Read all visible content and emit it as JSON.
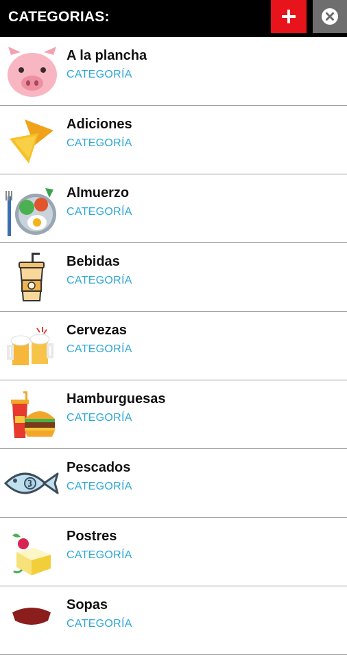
{
  "header": {
    "title": "CATEGORIAS:",
    "add_icon": "plus-icon",
    "close_icon": "close-circle-icon",
    "add_color": "#e8141c",
    "close_color": "#6e6e6e"
  },
  "categories": [
    {
      "name": "A la plancha",
      "subtitle": "CATEGORÍA",
      "icon": "pig-face-icon"
    },
    {
      "name": "Adiciones",
      "subtitle": "CATEGORÍA",
      "icon": "nachos-icon"
    },
    {
      "name": "Almuerzo",
      "subtitle": "CATEGORÍA",
      "icon": "lunch-plate-icon"
    },
    {
      "name": "Bebidas",
      "subtitle": "CATEGORÍA",
      "icon": "drink-cup-icon"
    },
    {
      "name": "Cervezas",
      "subtitle": "CATEGORÍA",
      "icon": "beer-mugs-icon"
    },
    {
      "name": "Hamburguesas",
      "subtitle": "CATEGORÍA",
      "icon": "burger-soda-icon"
    },
    {
      "name": "Pescados",
      "subtitle": "CATEGORÍA",
      "icon": "fish-icon"
    },
    {
      "name": "Postres",
      "subtitle": "CATEGORÍA",
      "icon": "cake-slice-icon"
    },
    {
      "name": "Sopas",
      "subtitle": "CATEGORÍA",
      "icon": "soup-bowl-icon"
    }
  ],
  "colors": {
    "subtitle": "#2aa7d6",
    "header_bg": "#000000"
  }
}
